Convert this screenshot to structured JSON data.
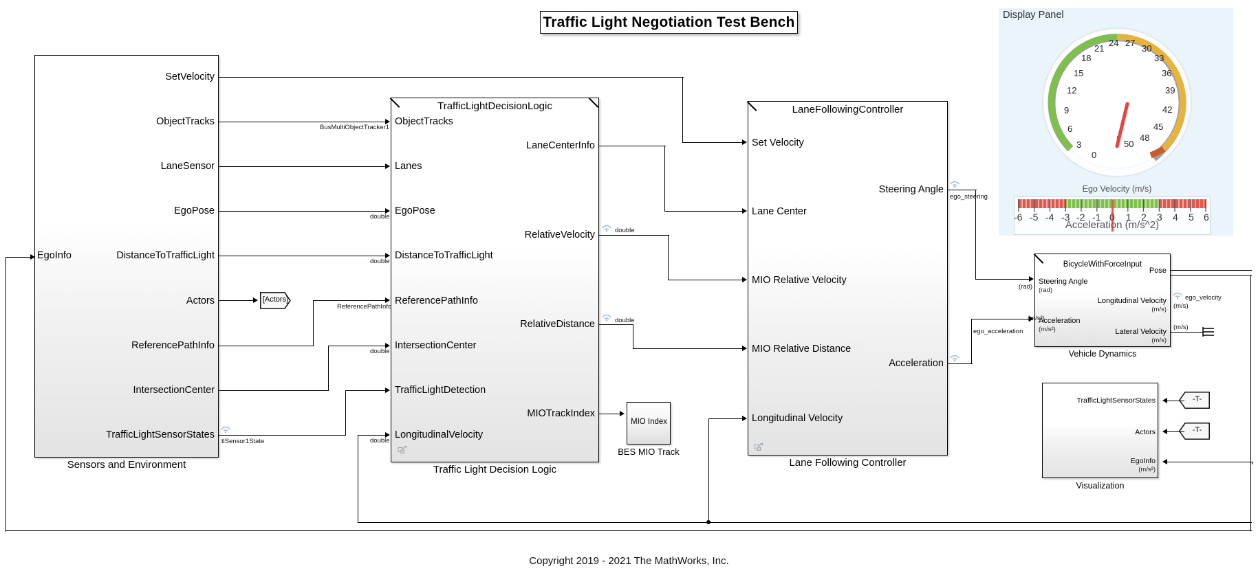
{
  "title_banner": {
    "text": "Traffic Light Negotiation Test Bench"
  },
  "copyright": {
    "text": "Copyright 2019 - 2021 The MathWorks, Inc."
  },
  "blocks": {
    "sensors": {
      "name": "Sensors and Environment",
      "inports": [
        "EgoInfo"
      ],
      "outports": [
        "SetVelocity",
        "ObjectTracks",
        "LaneSensor",
        "EgoPose",
        "DistanceToTrafficLight",
        "Actors",
        "ReferencePathInfo",
        "IntersectionCenter",
        "TrafficLightSensorStates"
      ]
    },
    "decision": {
      "title": "TrafficLightDecisionLogic",
      "name": "Traffic Light Decision Logic",
      "inports": [
        "ObjectTracks",
        "Lanes",
        "EgoPose",
        "DistanceToTrafficLight",
        "ReferencePathInfo",
        "IntersectionCenter",
        "TrafficLightDetection",
        "LongitudinalVelocity"
      ],
      "outports": [
        "LaneCenterInfo",
        "RelativeVelocity",
        "RelativeDistance",
        "MIOTrackIndex"
      ]
    },
    "controller": {
      "title": "LaneFollowingController",
      "name": "Lane Following Controller",
      "inports": [
        "Set Velocity",
        "Lane Center",
        "MIO Relative Velocity",
        "MIO Relative Distance",
        "Longitudinal Velocity"
      ],
      "outports": [
        "Steering Angle",
        "Acceleration"
      ]
    },
    "mio_track": {
      "name": "BES MIO Track",
      "inport": "MIO Index"
    },
    "vehicle_dynamics": {
      "title": "BicycleWithForceInput",
      "name": "Vehicle Dynamics",
      "inports": [
        {
          "label": "Steering Angle",
          "unit": "(rad)"
        },
        {
          "label": "Acceleration",
          "unit": "(m/s²)"
        }
      ],
      "outports": [
        {
          "label": "Pose",
          "unit": ""
        },
        {
          "label": "Longitudinal Velocity",
          "unit": "(m/s)"
        },
        {
          "label": "Lateral Velocity",
          "unit": "(m/s)"
        }
      ]
    },
    "visualization": {
      "name": "Visualization",
      "inports": [
        {
          "label": "TrafficLightSensorStates",
          "unit": ""
        },
        {
          "label": "Actors",
          "unit": ""
        },
        {
          "label": "EgoInfo",
          "unit": "(m/s²)"
        }
      ]
    }
  },
  "tags": {
    "actors_goto": "[Actors]",
    "tl_from": "-T-",
    "actors_from": "-T-"
  },
  "signal_labels": {
    "bus_multi_object_tracker": "BusMultiObjectTracker1",
    "double_egopose": "double",
    "double_dist": "double",
    "double_intersection": "double",
    "double_longvel": "double",
    "reference_path_info": "ReferencePathInfo",
    "tl_sensor_state": "tlSensor1State",
    "rel_velocity_double": "double",
    "rel_distance_double": "double",
    "ego_steering": "ego_steering",
    "ego_acceleration": "ego_acceleration",
    "ego_velocity": "ego_velocity",
    "rad_vd_in": "(rad)",
    "ms2_vd_in": "(m/s²)",
    "ms_longvel": "(m/s)",
    "ms_latvel": "(m/s)"
  },
  "display_panel": {
    "title": "Display Panel",
    "gauge": {
      "caption": "Ego Velocity (m/s)",
      "min": 0,
      "max": 50,
      "value": 0,
      "ticks": [
        0,
        3,
        6,
        9,
        12,
        15,
        18,
        21,
        24,
        27,
        30,
        33,
        36,
        39,
        42,
        45,
        48,
        50
      ],
      "zones": [
        {
          "from": 0,
          "to": 30,
          "color": "#7fc04a"
        },
        {
          "from": 30,
          "to": 45,
          "color": "#e8b33a"
        },
        {
          "from": 45,
          "to": 50,
          "color": "#cc5b2b"
        }
      ],
      "needle_color": "#e8433f"
    },
    "slider": {
      "caption": "Acceleration (m/s^2)",
      "min": -6,
      "max": 6,
      "value": 0,
      "ticks": [
        -6,
        -5,
        -4,
        -3,
        -2,
        -1,
        0,
        1,
        2,
        3,
        4,
        5,
        6
      ],
      "zones": [
        {
          "from": -6,
          "to": -3,
          "color": "#e2574c"
        },
        {
          "from": -3,
          "to": 3,
          "color": "#7fc04a"
        },
        {
          "from": 3,
          "to": 6,
          "color": "#e2574c"
        }
      ],
      "needle_color": "#ef5350"
    }
  },
  "colors": {
    "panel_bg": "#e9f4fb",
    "block_border": "#000000",
    "line": "#000000"
  }
}
